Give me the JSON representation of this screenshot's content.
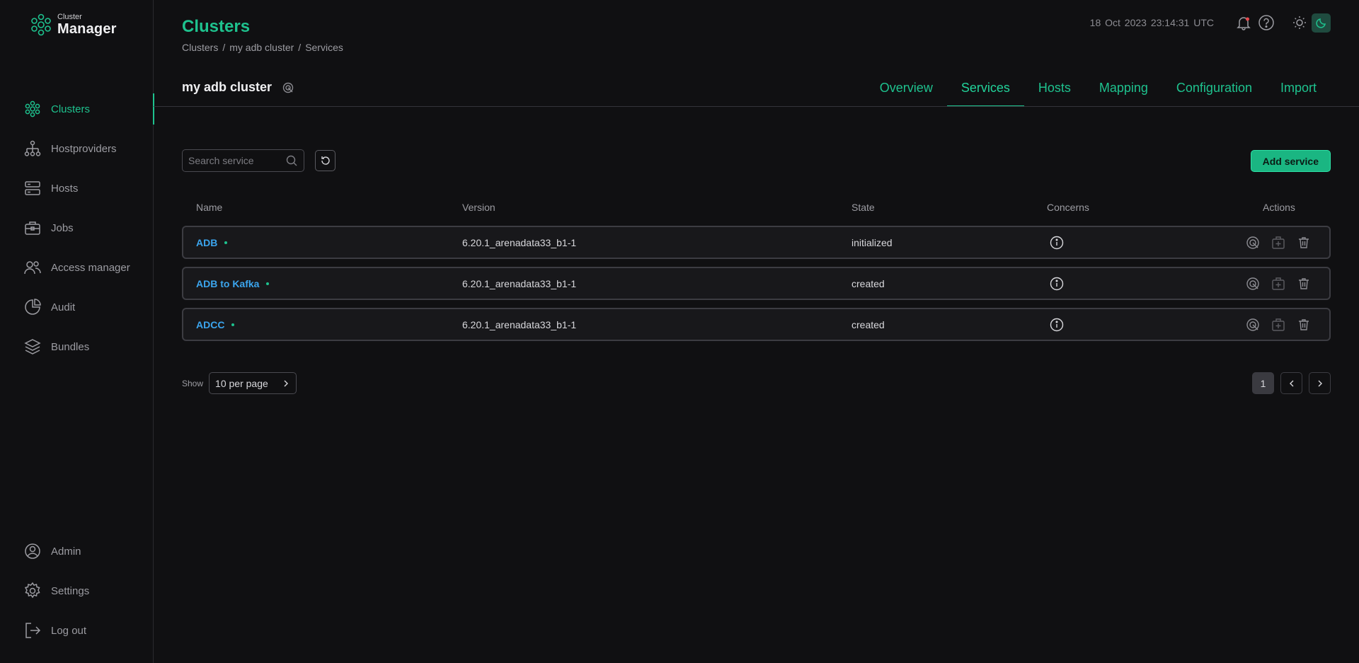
{
  "logo": {
    "small": "Cluster",
    "big": "Manager"
  },
  "sidebar": {
    "items": [
      {
        "label": "Clusters",
        "icon": "clusters-icon",
        "active": true
      },
      {
        "label": "Hostproviders",
        "icon": "hostproviders-icon"
      },
      {
        "label": "Hosts",
        "icon": "hosts-icon"
      },
      {
        "label": "Jobs",
        "icon": "jobs-icon"
      },
      {
        "label": "Access manager",
        "icon": "access-manager-icon"
      },
      {
        "label": "Audit",
        "icon": "audit-icon"
      },
      {
        "label": "Bundles",
        "icon": "bundles-icon"
      }
    ],
    "bottom": [
      {
        "label": "Admin",
        "icon": "admin-icon"
      },
      {
        "label": "Settings",
        "icon": "gear-icon"
      },
      {
        "label": "Log out",
        "icon": "logout-icon"
      }
    ]
  },
  "header": {
    "title": "Clusters",
    "breadcrumb": [
      "Clusters",
      "my adb cluster",
      "Services"
    ],
    "datetime": "18 Oct 2023  23:14:31  UTC"
  },
  "cluster": {
    "name": "my adb cluster"
  },
  "tabs": [
    "Overview",
    "Services",
    "Hosts",
    "Mapping",
    "Configuration",
    "Import"
  ],
  "active_tab": "Services",
  "search": {
    "placeholder": "Search service",
    "value": ""
  },
  "add_button": "Add service",
  "table": {
    "columns": [
      "Name",
      "Version",
      "State",
      "Concerns",
      "Actions"
    ],
    "rows": [
      {
        "name": "ADB",
        "version": "6.20.1_arenadata33_b1-1",
        "state": "initialized"
      },
      {
        "name": "ADB to Kafka",
        "version": "6.20.1_arenadata33_b1-1",
        "state": "created"
      },
      {
        "name": "ADCC",
        "version": "6.20.1_arenadata33_b1-1",
        "state": "created"
      }
    ]
  },
  "pagination": {
    "show_label": "Show",
    "per_page": "10 per page",
    "current_page": "1"
  },
  "colors": {
    "accent": "#1ec28e",
    "link": "#3ba5ee",
    "background": "#101012"
  }
}
